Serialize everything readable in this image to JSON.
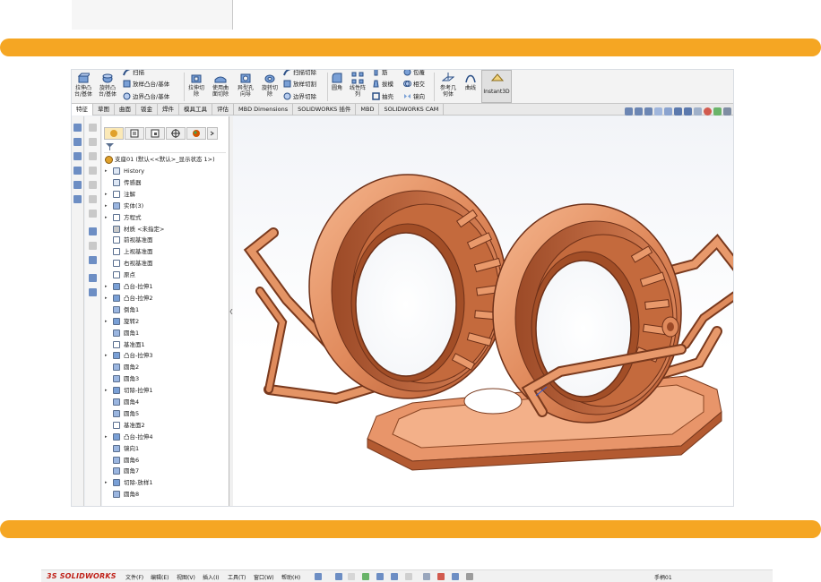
{
  "colors": {
    "separator_bar": "#f5a623",
    "model_copper_light": "#f2a77c",
    "model_copper_mid": "#d97a4d",
    "model_copper_dark": "#8a3f22",
    "tree_icon_blue": "#5a6f8f",
    "logo_red": "#c0231b"
  },
  "ribbon": {
    "extrude_boss": "拉伸凸\n台/基体",
    "revolve_boss": "旋转凸\n台/基体",
    "sweep_boss": "扫描",
    "loft_boss": "放样凸台/基体",
    "boundary_boss": "边界凸台/基体",
    "extrude_cut": "拉伸切\n除",
    "surface_cut": "使用曲\n面切除",
    "hole_wizard": "异型孔\n向导",
    "revolve_cut": "旋转切\n除",
    "sweep_cut": "扫描切除",
    "loft_cut": "放样切割",
    "boundary_cut": "边界切除",
    "fillet": "圆角",
    "linear_pattern": "线性阵\n列",
    "rib": "筋",
    "draft": "拔模",
    "shell": "抽壳",
    "wrap": "包覆",
    "intersect": "相交",
    "mirror": "镜向",
    "ref_geometry": "参考几\n何体",
    "curves": "曲线",
    "instant3d": "Instant3D"
  },
  "tabs": [
    "特征",
    "草图",
    "曲面",
    "钣金",
    "焊件",
    "模具工具",
    "评估",
    "MBD Dimensions",
    "SOLIDWORKS 插件",
    "MBD",
    "SOLIDWORKS CAM"
  ],
  "active_tab": "特征",
  "tree": {
    "root": "支座01 (默认<<默认>_显示状态 1>)",
    "items": [
      {
        "label": "History",
        "icon": "history-icon",
        "expand": true
      },
      {
        "label": "传感器",
        "icon": "sensor-icon",
        "expand": false
      },
      {
        "label": "注解",
        "icon": "annotation-icon",
        "expand": true
      },
      {
        "label": "实体(3)",
        "icon": "solid-bodies-icon",
        "expand": true
      },
      {
        "label": "方程式",
        "icon": "equation-icon",
        "expand": true
      },
      {
        "label": "材质 <未指定>",
        "icon": "material-icon",
        "expand": false
      },
      {
        "label": "前视基准面",
        "icon": "plane-icon",
        "expand": false
      },
      {
        "label": "上视基准面",
        "icon": "plane-icon",
        "expand": false
      },
      {
        "label": "右视基准面",
        "icon": "plane-icon",
        "expand": false
      },
      {
        "label": "原点",
        "icon": "origin-icon",
        "expand": false
      },
      {
        "label": "凸台-拉伸1",
        "icon": "extrude-icon",
        "expand": true
      },
      {
        "label": "凸台-拉伸2",
        "icon": "extrude-icon",
        "expand": true
      },
      {
        "label": "倒角1",
        "icon": "chamfer-icon",
        "expand": false
      },
      {
        "label": "旋转2",
        "icon": "revolve-icon",
        "expand": true
      },
      {
        "label": "圆角1",
        "icon": "fillet-icon",
        "expand": false
      },
      {
        "label": "基准面1",
        "icon": "plane-icon",
        "expand": false
      },
      {
        "label": "凸台-拉伸3",
        "icon": "extrude-icon",
        "expand": true
      },
      {
        "label": "圆角2",
        "icon": "fillet-icon",
        "expand": false
      },
      {
        "label": "圆角3",
        "icon": "fillet-icon",
        "expand": false
      },
      {
        "label": "切除-拉伸1",
        "icon": "cut-extrude-icon",
        "expand": true
      },
      {
        "label": "圆角4",
        "icon": "fillet-icon",
        "expand": false
      },
      {
        "label": "圆角5",
        "icon": "fillet-icon",
        "expand": false
      },
      {
        "label": "基准面2",
        "icon": "plane-icon",
        "expand": false
      },
      {
        "label": "凸台-拉伸4",
        "icon": "extrude-icon",
        "expand": true
      },
      {
        "label": "镜向1",
        "icon": "mirror-icon",
        "expand": false
      },
      {
        "label": "圆角6",
        "icon": "fillet-icon",
        "expand": false
      },
      {
        "label": "圆角7",
        "icon": "fillet-icon",
        "expand": false
      },
      {
        "label": "切除-放样1",
        "icon": "cut-loft-icon",
        "expand": true
      },
      {
        "label": "圆角8",
        "icon": "fillet-icon",
        "expand": false
      }
    ]
  },
  "bottom": {
    "logo": "3S SOLIDWORKS",
    "menus": [
      "文件(F)",
      "编辑(E)",
      "视图(V)",
      "插入(I)",
      "工具(T)",
      "窗口(W)",
      "帮助(H)"
    ],
    "doc_title": "手柄01"
  }
}
